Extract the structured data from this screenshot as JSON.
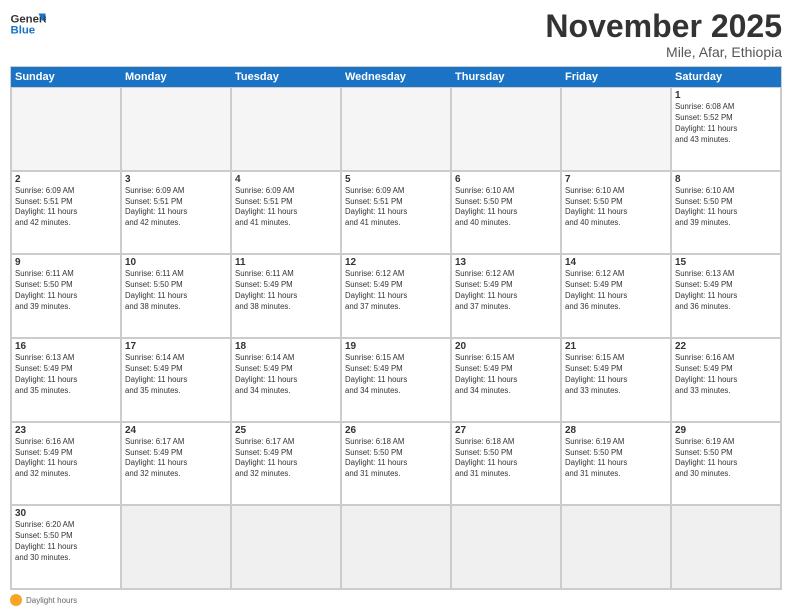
{
  "header": {
    "logo_general": "General",
    "logo_blue": "Blue",
    "month_title": "November 2025",
    "location": "Mile, Afar, Ethiopia"
  },
  "day_headers": [
    "Sunday",
    "Monday",
    "Tuesday",
    "Wednesday",
    "Thursday",
    "Friday",
    "Saturday"
  ],
  "footer": {
    "label": "Daylight hours"
  },
  "weeks": [
    [
      {
        "num": "",
        "info": "",
        "empty": true
      },
      {
        "num": "",
        "info": "",
        "empty": true
      },
      {
        "num": "",
        "info": "",
        "empty": true
      },
      {
        "num": "",
        "info": "",
        "empty": true
      },
      {
        "num": "",
        "info": "",
        "empty": true
      },
      {
        "num": "",
        "info": "",
        "empty": true
      },
      {
        "num": "1",
        "info": "Sunrise: 6:08 AM\nSunset: 5:52 PM\nDaylight: 11 hours\nand 43 minutes."
      }
    ],
    [
      {
        "num": "2",
        "info": "Sunrise: 6:09 AM\nSunset: 5:51 PM\nDaylight: 11 hours\nand 42 minutes."
      },
      {
        "num": "3",
        "info": "Sunrise: 6:09 AM\nSunset: 5:51 PM\nDaylight: 11 hours\nand 42 minutes."
      },
      {
        "num": "4",
        "info": "Sunrise: 6:09 AM\nSunset: 5:51 PM\nDaylight: 11 hours\nand 41 minutes."
      },
      {
        "num": "5",
        "info": "Sunrise: 6:09 AM\nSunset: 5:51 PM\nDaylight: 11 hours\nand 41 minutes."
      },
      {
        "num": "6",
        "info": "Sunrise: 6:10 AM\nSunset: 5:50 PM\nDaylight: 11 hours\nand 40 minutes."
      },
      {
        "num": "7",
        "info": "Sunrise: 6:10 AM\nSunset: 5:50 PM\nDaylight: 11 hours\nand 40 minutes."
      },
      {
        "num": "8",
        "info": "Sunrise: 6:10 AM\nSunset: 5:50 PM\nDaylight: 11 hours\nand 39 minutes."
      }
    ],
    [
      {
        "num": "9",
        "info": "Sunrise: 6:11 AM\nSunset: 5:50 PM\nDaylight: 11 hours\nand 39 minutes."
      },
      {
        "num": "10",
        "info": "Sunrise: 6:11 AM\nSunset: 5:50 PM\nDaylight: 11 hours\nand 38 minutes."
      },
      {
        "num": "11",
        "info": "Sunrise: 6:11 AM\nSunset: 5:49 PM\nDaylight: 11 hours\nand 38 minutes."
      },
      {
        "num": "12",
        "info": "Sunrise: 6:12 AM\nSunset: 5:49 PM\nDaylight: 11 hours\nand 37 minutes."
      },
      {
        "num": "13",
        "info": "Sunrise: 6:12 AM\nSunset: 5:49 PM\nDaylight: 11 hours\nand 37 minutes."
      },
      {
        "num": "14",
        "info": "Sunrise: 6:12 AM\nSunset: 5:49 PM\nDaylight: 11 hours\nand 36 minutes."
      },
      {
        "num": "15",
        "info": "Sunrise: 6:13 AM\nSunset: 5:49 PM\nDaylight: 11 hours\nand 36 minutes."
      }
    ],
    [
      {
        "num": "16",
        "info": "Sunrise: 6:13 AM\nSunset: 5:49 PM\nDaylight: 11 hours\nand 35 minutes."
      },
      {
        "num": "17",
        "info": "Sunrise: 6:14 AM\nSunset: 5:49 PM\nDaylight: 11 hours\nand 35 minutes."
      },
      {
        "num": "18",
        "info": "Sunrise: 6:14 AM\nSunset: 5:49 PM\nDaylight: 11 hours\nand 34 minutes."
      },
      {
        "num": "19",
        "info": "Sunrise: 6:15 AM\nSunset: 5:49 PM\nDaylight: 11 hours\nand 34 minutes."
      },
      {
        "num": "20",
        "info": "Sunrise: 6:15 AM\nSunset: 5:49 PM\nDaylight: 11 hours\nand 34 minutes."
      },
      {
        "num": "21",
        "info": "Sunrise: 6:15 AM\nSunset: 5:49 PM\nDaylight: 11 hours\nand 33 minutes."
      },
      {
        "num": "22",
        "info": "Sunrise: 6:16 AM\nSunset: 5:49 PM\nDaylight: 11 hours\nand 33 minutes."
      }
    ],
    [
      {
        "num": "23",
        "info": "Sunrise: 6:16 AM\nSunset: 5:49 PM\nDaylight: 11 hours\nand 32 minutes."
      },
      {
        "num": "24",
        "info": "Sunrise: 6:17 AM\nSunset: 5:49 PM\nDaylight: 11 hours\nand 32 minutes."
      },
      {
        "num": "25",
        "info": "Sunrise: 6:17 AM\nSunset: 5:49 PM\nDaylight: 11 hours\nand 32 minutes."
      },
      {
        "num": "26",
        "info": "Sunrise: 6:18 AM\nSunset: 5:50 PM\nDaylight: 11 hours\nand 31 minutes."
      },
      {
        "num": "27",
        "info": "Sunrise: 6:18 AM\nSunset: 5:50 PM\nDaylight: 11 hours\nand 31 minutes."
      },
      {
        "num": "28",
        "info": "Sunrise: 6:19 AM\nSunset: 5:50 PM\nDaylight: 11 hours\nand 31 minutes."
      },
      {
        "num": "29",
        "info": "Sunrise: 6:19 AM\nSunset: 5:50 PM\nDaylight: 11 hours\nand 30 minutes."
      }
    ],
    [
      {
        "num": "30",
        "info": "Sunrise: 6:20 AM\nSunset: 5:50 PM\nDaylight: 11 hours\nand 30 minutes."
      },
      {
        "num": "",
        "info": "",
        "empty": true,
        "gray": true
      },
      {
        "num": "",
        "info": "",
        "empty": true,
        "gray": true
      },
      {
        "num": "",
        "info": "",
        "empty": true,
        "gray": true
      },
      {
        "num": "",
        "info": "",
        "empty": true,
        "gray": true
      },
      {
        "num": "",
        "info": "",
        "empty": true,
        "gray": true
      },
      {
        "num": "",
        "info": "",
        "empty": true,
        "gray": true
      }
    ]
  ]
}
